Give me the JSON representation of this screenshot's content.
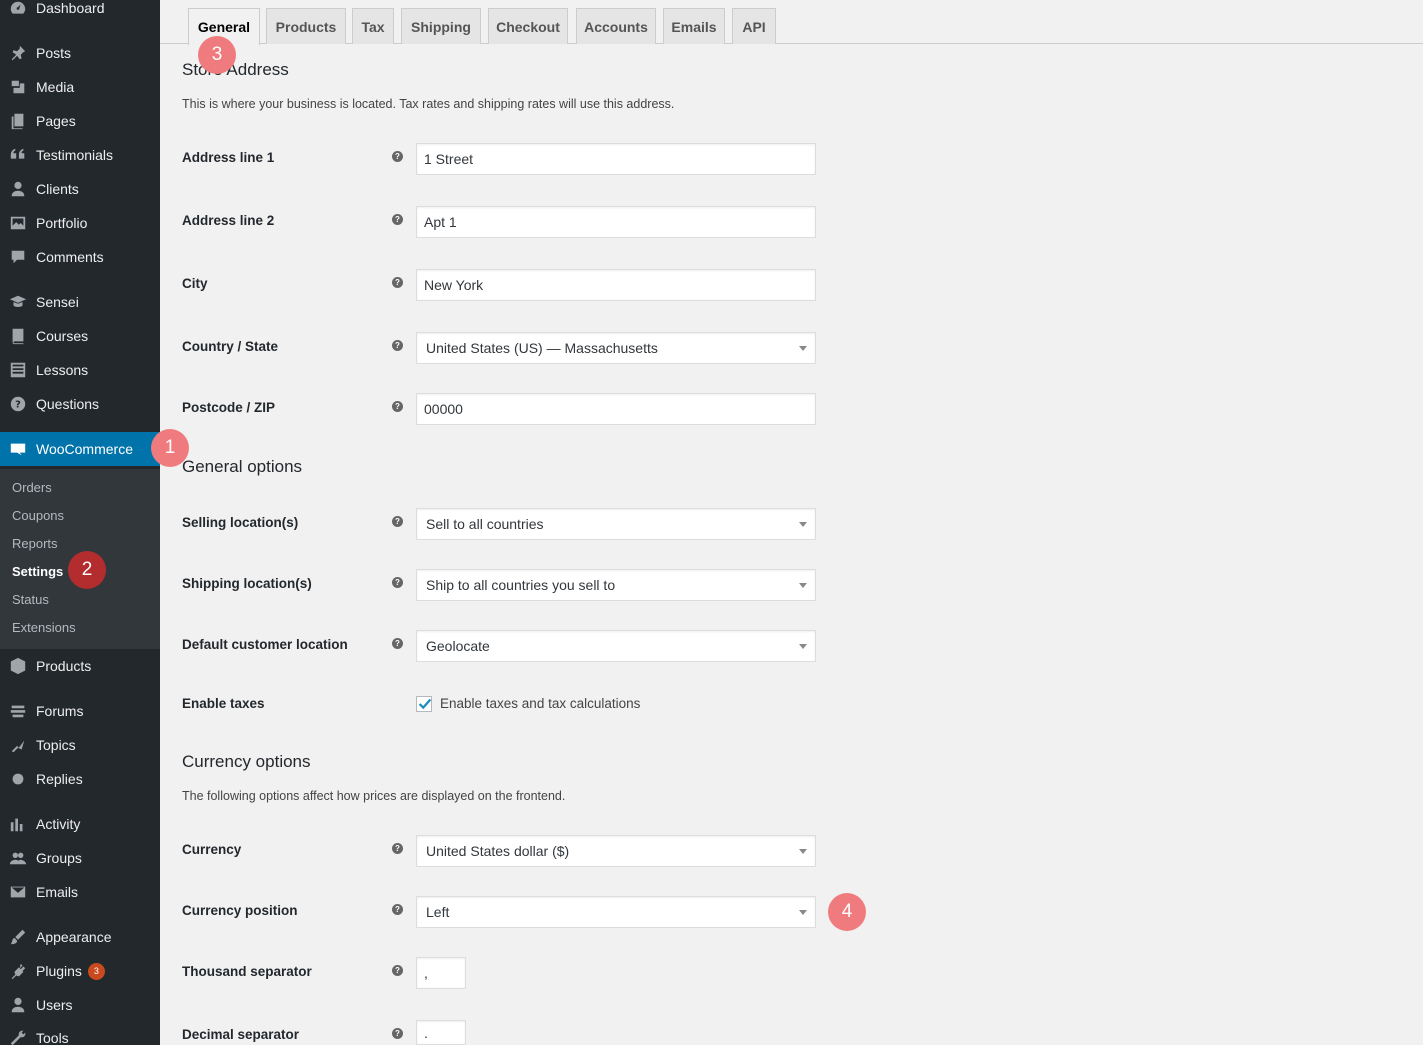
{
  "sidebar": {
    "items": [
      {
        "label": "Dashboard",
        "icon": "dashboard-icon"
      },
      {
        "label": "Posts",
        "icon": "pin-icon"
      },
      {
        "label": "Media",
        "icon": "media-icon"
      },
      {
        "label": "Pages",
        "icon": "pages-icon"
      },
      {
        "label": "Testimonials",
        "icon": "quote-icon"
      },
      {
        "label": "Clients",
        "icon": "user-icon"
      },
      {
        "label": "Portfolio",
        "icon": "portfolio-icon"
      },
      {
        "label": "Comments",
        "icon": "comment-icon"
      },
      {
        "label": "Sensei",
        "icon": "graduation-cap-icon"
      },
      {
        "label": "Courses",
        "icon": "book-icon"
      },
      {
        "label": "Lessons",
        "icon": "list-icon"
      },
      {
        "label": "Questions",
        "icon": "question-icon"
      },
      {
        "label": "WooCommerce",
        "icon": "woo-icon"
      },
      {
        "label": "Products",
        "icon": "box-icon"
      },
      {
        "label": "Forums",
        "icon": "forums-icon"
      },
      {
        "label": "Topics",
        "icon": "topics-icon"
      },
      {
        "label": "Replies",
        "icon": "replies-icon"
      },
      {
        "label": "Activity",
        "icon": "activity-icon"
      },
      {
        "label": "Groups",
        "icon": "groups-icon"
      },
      {
        "label": "Emails",
        "icon": "email-icon"
      },
      {
        "label": "Appearance",
        "icon": "brush-icon"
      },
      {
        "label": "Plugins",
        "icon": "plug-icon",
        "badge": "3"
      },
      {
        "label": "Users",
        "icon": "users-icon"
      },
      {
        "label": "Tools",
        "icon": "wrench-icon"
      }
    ],
    "submenu": [
      "Orders",
      "Coupons",
      "Reports",
      "Settings",
      "Status",
      "Extensions"
    ]
  },
  "tabs": [
    "General",
    "Products",
    "Tax",
    "Shipping",
    "Checkout",
    "Accounts",
    "Emails",
    "API"
  ],
  "store_address": {
    "title": "Store Address",
    "description": "This is where your business is located. Tax rates and shipping rates will use this address.",
    "fields": [
      {
        "label": "Address line 1",
        "value": "1 Street"
      },
      {
        "label": "Address line 2",
        "value": "Apt 1"
      },
      {
        "label": "City",
        "value": "New York"
      },
      {
        "label": "Country / State",
        "value": "United States (US) — Massachusetts"
      },
      {
        "label": "Postcode / ZIP",
        "value": "00000"
      }
    ]
  },
  "general_options": {
    "title": "General options",
    "fields": [
      {
        "label": "Selling location(s)",
        "value": "Sell to all countries"
      },
      {
        "label": "Shipping location(s)",
        "value": "Ship to all countries you sell to"
      },
      {
        "label": "Default customer location",
        "value": "Geolocate"
      },
      {
        "label": "Enable taxes",
        "value": "Enable taxes and tax calculations"
      }
    ]
  },
  "currency_options": {
    "title": "Currency options",
    "description": "The following options affect how prices are displayed on the frontend.",
    "fields": [
      {
        "label": "Currency",
        "value": "United States dollar ($)"
      },
      {
        "label": "Currency position",
        "value": "Left"
      },
      {
        "label": "Thousand separator",
        "value": ","
      },
      {
        "label": "Decimal separator",
        "value": "."
      }
    ]
  },
  "markers": [
    "1",
    "2",
    "3",
    "4"
  ],
  "colors": {
    "sidebar": "#23282d",
    "submenu": "#32373c",
    "active": "#0073aa",
    "marker_light": "#f07b7e",
    "marker_dark": "#b32d2e",
    "badge": "#ca4a1f"
  }
}
